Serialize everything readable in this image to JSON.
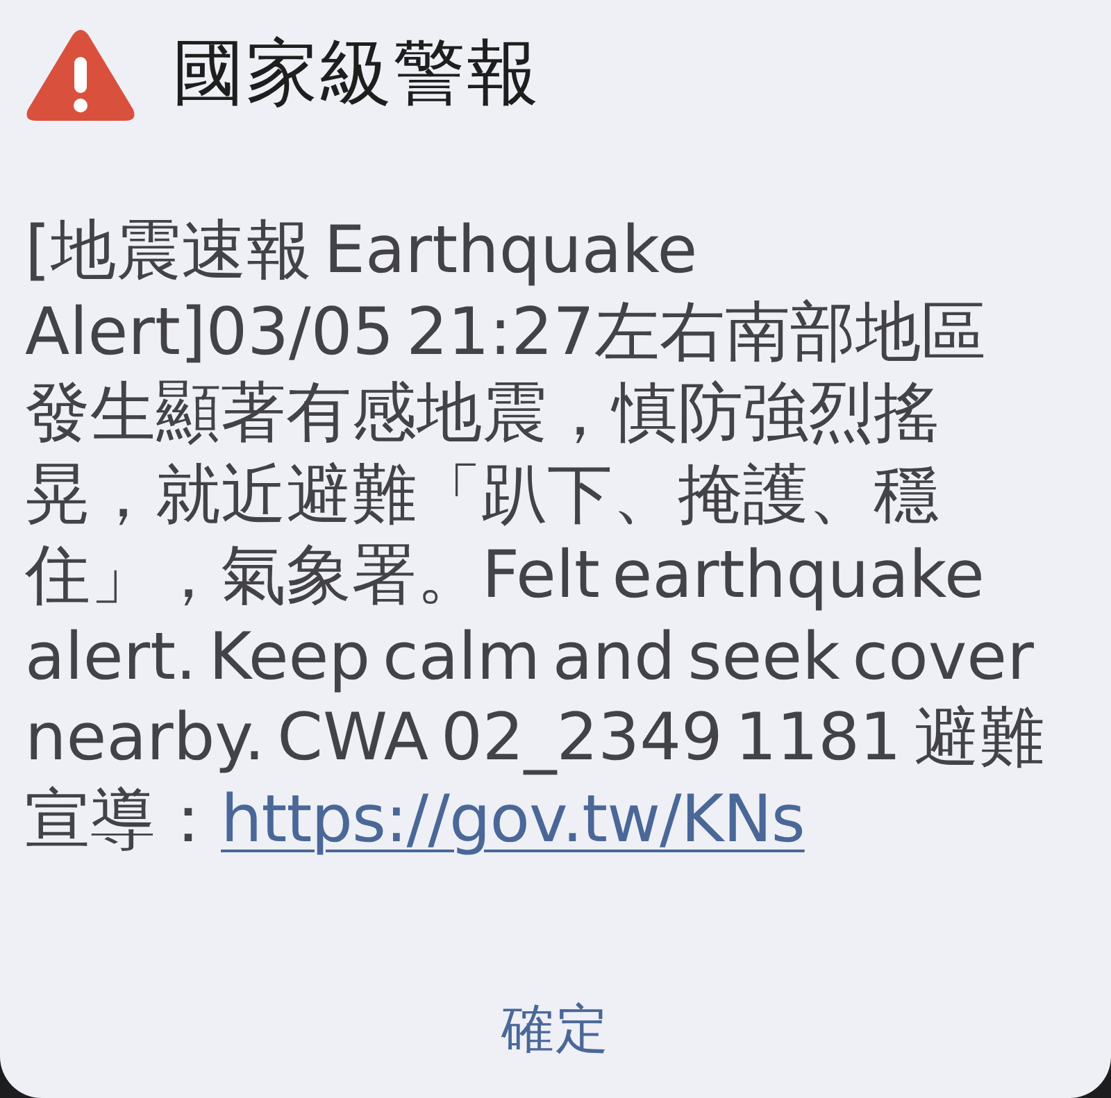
{
  "alert": {
    "title": "國家級警報",
    "message": "[地震速報 Earthquake Alert]03/05 21:27左右南部地區發生顯著有感地震，慎防強烈搖晃，就近避難「趴下、掩護、穩住」，氣象署。Felt earthquake alert. Keep calm and seek cover nearby. CWA 02_2349 1181 避難宣導：",
    "link": "https://gov.tw/KNs"
  },
  "buttons": [
    "確定"
  ]
}
